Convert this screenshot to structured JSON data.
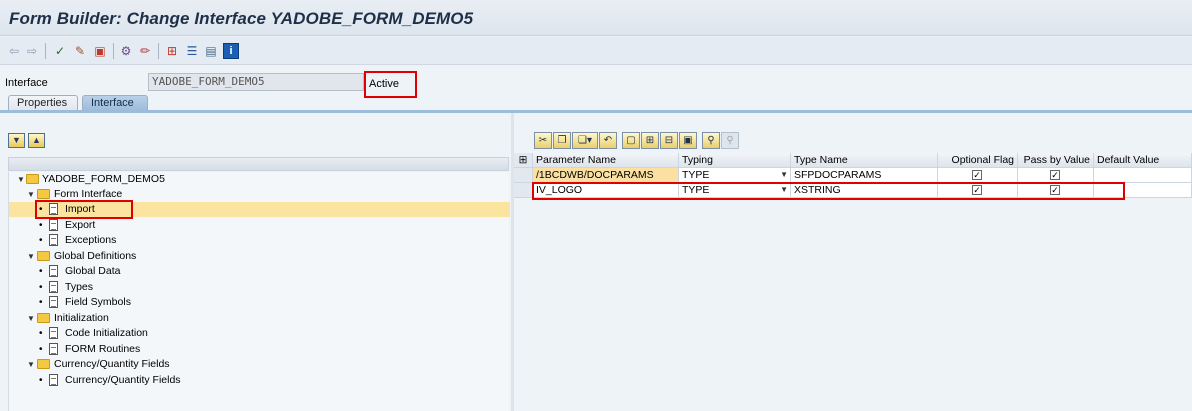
{
  "window": {
    "title": "Form Builder: Change Interface YADOBE_FORM_DEMO5"
  },
  "toolbar": {
    "icons": [
      "back-arrow-icon",
      "forward-arrow-icon",
      "check-icon",
      "display-change-icon",
      "activate-icon",
      "other-object-icon",
      "pencil-icon",
      "hierarchy-icon",
      "tree-icon",
      "layout-icon",
      "info-icon"
    ]
  },
  "header": {
    "label": "Interface",
    "value": "YADOBE_FORM_DEMO5",
    "status": "Active",
    "tabs": [
      {
        "label": "Properties"
      },
      {
        "label": "Interface"
      }
    ]
  },
  "tree": {
    "nodes": [
      {
        "label": "YADOBE_FORM_DEMO5"
      },
      {
        "label": "Form Interface"
      },
      {
        "label": "Import"
      },
      {
        "label": "Export"
      },
      {
        "label": "Exceptions"
      },
      {
        "label": "Global Definitions"
      },
      {
        "label": "Global Data"
      },
      {
        "label": "Types"
      },
      {
        "label": "Field Symbols"
      },
      {
        "label": "Initialization"
      },
      {
        "label": "Code Initialization"
      },
      {
        "label": "FORM Routines"
      },
      {
        "label": "Currency/Quantity Fields"
      },
      {
        "label": "Currency/Quantity Fields"
      }
    ]
  },
  "grid": {
    "columns": [
      "Parameter Name",
      "Typing",
      "Type Name",
      "Optional Flag",
      "Pass by Value",
      "Default Value"
    ],
    "rows": [
      {
        "param": "/1BCDWB/DOCPARAMS",
        "typing": "TYPE",
        "type_name": "SFPDOCPARAMS",
        "optional": "✓",
        "pass_by_value": "✓",
        "default": ""
      },
      {
        "param": "IV_LOGO",
        "typing": "TYPE",
        "type_name": "XSTRING",
        "optional": "✓",
        "pass_by_value": "✓",
        "default": ""
      }
    ]
  },
  "colors": {
    "highlight": "#e00000",
    "selected_row": "#fbe4a0",
    "active_tab": "#9dbbda"
  }
}
